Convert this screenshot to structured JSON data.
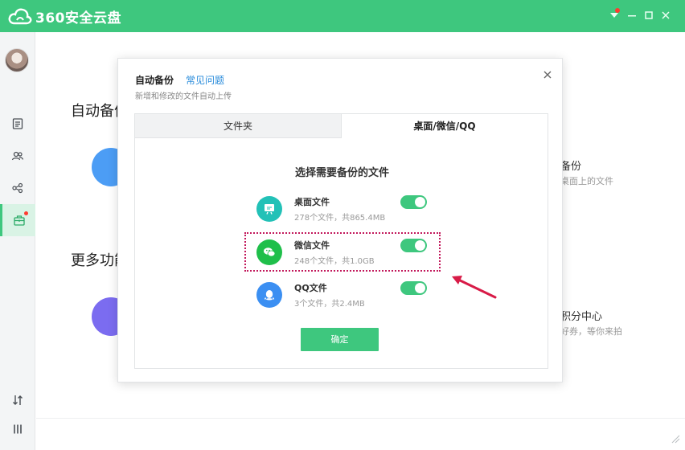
{
  "app": {
    "brand": "360安全云盘"
  },
  "titlebar": {
    "icons": [
      "menu-icon",
      "minimize-icon",
      "maximize-icon",
      "close-icon"
    ]
  },
  "sidebar": {
    "icons": [
      "avatar",
      "file-icon",
      "contacts-icon",
      "share-icon",
      "toolbox-icon",
      "transfer-icon",
      "more-icon"
    ]
  },
  "background": {
    "section1_title": "自动备份",
    "section2_title": "更多功能",
    "right1_title": "备份",
    "right1_sub": "桌面上的文件",
    "right2_title": "积分中心",
    "right2_sub": "好券，等你来拍"
  },
  "dialog": {
    "title": "自动备份",
    "faq_link": "常见问题",
    "subtitle": "新增和修改的文件自动上传",
    "tabs": [
      "文件夹",
      "桌面/微信/QQ"
    ],
    "active_tab": "桌面/微信/QQ",
    "choose_title": "选择需要备份的文件",
    "items": [
      {
        "name": "桌面文件",
        "info": "278个文件，共865.4MB",
        "enabled": true,
        "color": "#22c1b7"
      },
      {
        "name": "微信文件",
        "info": "248个文件，共1.0GB",
        "enabled": true,
        "color": "#1fbf4a"
      },
      {
        "name": "QQ文件",
        "info": "3个文件，共2.4MB",
        "enabled": true,
        "color": "#3b8ff2"
      }
    ],
    "confirm_label": "确定"
  },
  "colors": {
    "accent": "#3ec77e",
    "highlight": "#c2185b",
    "link": "#2a8cdb"
  }
}
